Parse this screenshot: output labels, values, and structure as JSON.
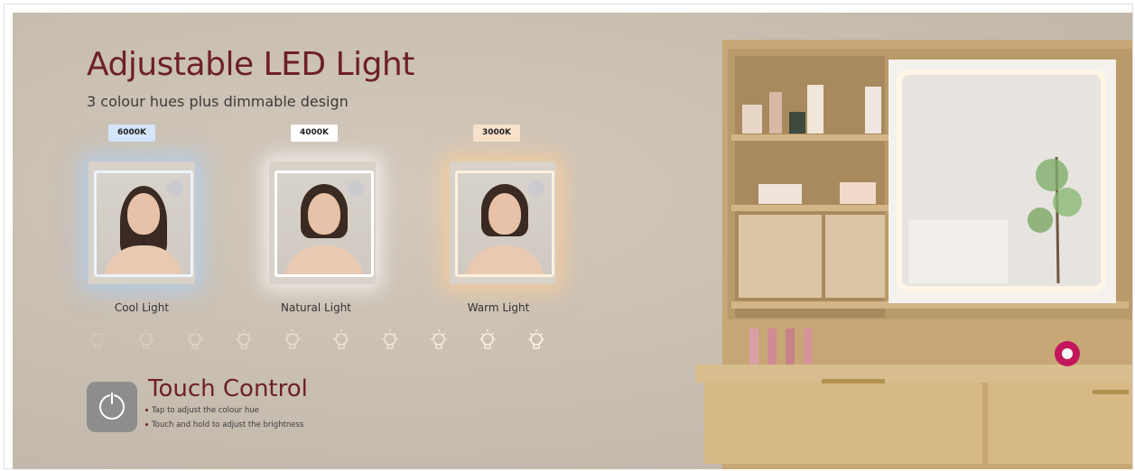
{
  "banner": {
    "title": "Adjustable LED Light",
    "subtitle": "3 colour hues plus dimmable design",
    "modes": [
      {
        "temp": "6000K",
        "label": "Cool Light",
        "glow": "#cfe4ff"
      },
      {
        "temp": "4000K",
        "label": "Natural Light",
        "glow": "#ffffff"
      },
      {
        "temp": "3000K",
        "label": "Warm Light",
        "glow": "#f8e1c6"
      }
    ],
    "brightness_levels": 10,
    "touch": {
      "title": "Touch Control",
      "items": [
        "Tap to adjust the colour hue",
        "Touch and hold to adjust the brightness"
      ]
    }
  },
  "colors": {
    "accent": "#6e1f2a",
    "background": "#c9bfb2",
    "button": "#8d8d8d"
  },
  "icons": [
    "power-icon",
    "light-bulb-icon"
  ]
}
